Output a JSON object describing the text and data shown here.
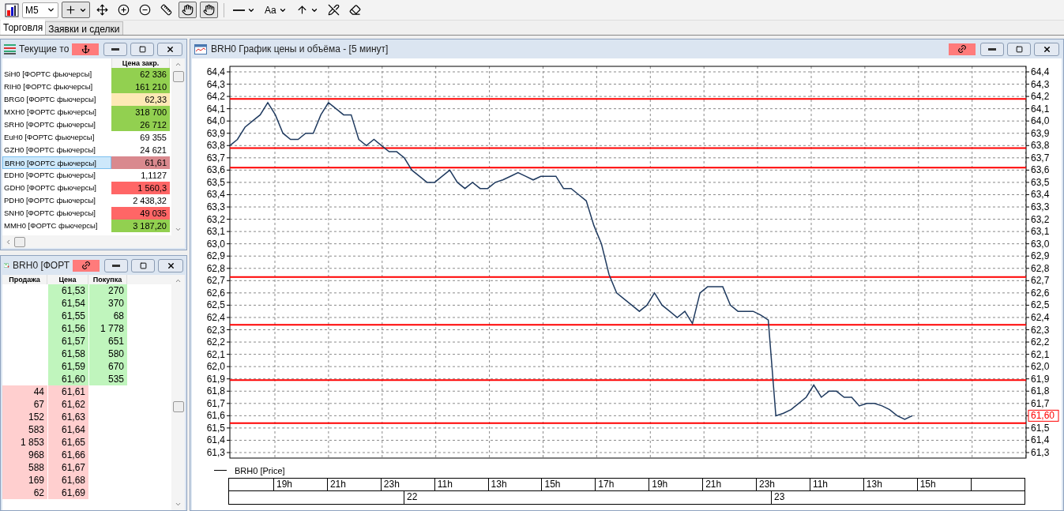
{
  "toolbar": {
    "timeframe": "M5",
    "tools": [
      {
        "kind": "icon",
        "pressed": true,
        "menu": true
      },
      {
        "kind": "icon",
        "pressed": false,
        "menu": false
      },
      {
        "kind": "icon",
        "pressed": false,
        "menu": false
      },
      {
        "kind": "icon",
        "pressed": false,
        "menu": false
      },
      {
        "kind": "icon",
        "pressed": false,
        "menu": false
      },
      {
        "kind": "icon",
        "pressed": true,
        "menu": false
      },
      {
        "kind": "icon",
        "pressed": true,
        "menu": false
      },
      {
        "kind": "separator"
      },
      {
        "kind": "icon",
        "pressed": false,
        "menu": true
      },
      {
        "kind": "text",
        "label": "Aa",
        "pressed": false,
        "menu": true
      },
      {
        "kind": "icon",
        "pressed": false,
        "menu": true
      },
      {
        "kind": "icon",
        "pressed": false,
        "menu": false
      },
      {
        "kind": "icon",
        "pressed": false,
        "menu": false
      }
    ]
  },
  "tabs": [
    {
      "label": "Торговля",
      "selected": true
    },
    {
      "label": "Заявки и сделки",
      "selected": false
    }
  ],
  "current_trades": {
    "title": "Текущие то",
    "columns": [
      "Цена закр."
    ],
    "rows": [
      {
        "name": "SiH0 [ФОРТС фьючерсы]",
        "value": "62 336",
        "color": "#92d050",
        "selected": false
      },
      {
        "name": "RIH0 [ФОРТС фьючерсы]",
        "value": "161 210",
        "color": "#92d050",
        "selected": false
      },
      {
        "name": "BRG0 [ФОРТС фьючерсы]",
        "value": "62,33",
        "color": "#fde9b5",
        "selected": false
      },
      {
        "name": "MXH0 [ФОРТС фьючерсы]",
        "value": "318 700",
        "color": "#92d050",
        "selected": false
      },
      {
        "name": "SRH0 [ФОРТС фьючерсы]",
        "value": "26 712",
        "color": "#92d050",
        "selected": false
      },
      {
        "name": "EuH0 [ФОРТС фьючерсы]",
        "value": "69 355",
        "color": "#ffffff",
        "selected": false
      },
      {
        "name": "GZH0 [ФОРТС фьючерсы]",
        "value": "24 621",
        "color": "#ffffff",
        "selected": false
      },
      {
        "name": "BRH0 [ФОРТС фьючерсы]",
        "value": "61,61",
        "color": "#d9898e",
        "selected": true
      },
      {
        "name": "EDH0 [ФОРТС фьючерсы]",
        "value": "1,1127",
        "color": "#ffffff",
        "selected": false
      },
      {
        "name": "GDH0 [ФОРТС фьючерсы]",
        "value": "1 560,3",
        "color": "#ff6666",
        "selected": false
      },
      {
        "name": "PDH0 [ФОРТС фьючерсы]",
        "value": "2 438,32",
        "color": "#ffffff",
        "selected": false
      },
      {
        "name": "SNH0 [ФОРТС фьючерсы]",
        "value": "49 035",
        "color": "#ff6666",
        "selected": false
      },
      {
        "name": "MMH0 [ФОРТС фьючерсы]",
        "value": "3 187,20",
        "color": "#92d050",
        "selected": false
      }
    ]
  },
  "order_book": {
    "title": "BRH0 [ФОРТ",
    "columns": [
      "Продажа",
      "Цена",
      "Покупка"
    ],
    "rows": [
      {
        "kind": "bid",
        "price": "61,53",
        "buy": "270"
      },
      {
        "kind": "bid",
        "price": "61,54",
        "buy": "370"
      },
      {
        "kind": "bid",
        "price": "61,55",
        "buy": "68"
      },
      {
        "kind": "bid",
        "price": "61,56",
        "buy": "1 778"
      },
      {
        "kind": "bid",
        "price": "61,57",
        "buy": "651"
      },
      {
        "kind": "bid",
        "price": "61,58",
        "buy": "580"
      },
      {
        "kind": "bid",
        "price": "61,59",
        "buy": "670"
      },
      {
        "kind": "bid",
        "price": "61,60",
        "buy": "535"
      },
      {
        "kind": "ask",
        "sell": "44",
        "price": "61,61"
      },
      {
        "kind": "ask",
        "sell": "67",
        "price": "61,62"
      },
      {
        "kind": "ask",
        "sell": "152",
        "price": "61,63"
      },
      {
        "kind": "ask",
        "sell": "583",
        "price": "61,64"
      },
      {
        "kind": "ask",
        "sell": "1 853",
        "price": "61,65"
      },
      {
        "kind": "ask",
        "sell": "968",
        "price": "61,66"
      },
      {
        "kind": "ask",
        "sell": "588",
        "price": "61,67"
      },
      {
        "kind": "ask",
        "sell": "169",
        "price": "61,68"
      },
      {
        "kind": "ask",
        "sell": "62",
        "price": "61,69"
      }
    ]
  },
  "chart_window": {
    "title": "BRH0 График цены и объёма - [5 минут]",
    "chart_data": {
      "type": "line",
      "grid": true,
      "ylim": [
        61.255,
        64.445
      ],
      "yticks": [
        {
          "value": 61.3,
          "label": "61,3"
        },
        {
          "value": 61.4,
          "label": "61,4"
        },
        {
          "value": 61.5,
          "label": "61,5"
        },
        {
          "value": 61.6,
          "label": "61,6"
        },
        {
          "value": 61.7,
          "label": "61,7"
        },
        {
          "value": 61.8,
          "label": "61,8"
        },
        {
          "value": 61.9,
          "label": "61,9"
        },
        {
          "value": 62.0,
          "label": "62,0"
        },
        {
          "value": 62.1,
          "label": "62,1"
        },
        {
          "value": 62.2,
          "label": "62,2"
        },
        {
          "value": 62.3,
          "label": "62,3"
        },
        {
          "value": 62.4,
          "label": "62,4"
        },
        {
          "value": 62.5,
          "label": "62,5"
        },
        {
          "value": 62.6,
          "label": "62,6"
        },
        {
          "value": 62.7,
          "label": "62,7"
        },
        {
          "value": 62.8,
          "label": "62,8"
        },
        {
          "value": 62.9,
          "label": "62,9"
        },
        {
          "value": 63.0,
          "label": "63,0"
        },
        {
          "value": 63.1,
          "label": "63,1"
        },
        {
          "value": 63.2,
          "label": "63,2"
        },
        {
          "value": 63.3,
          "label": "63,3"
        },
        {
          "value": 63.4,
          "label": "63,4"
        },
        {
          "value": 63.5,
          "label": "63,5"
        },
        {
          "value": 63.6,
          "label": "63,6"
        },
        {
          "value": 63.7,
          "label": "63,7"
        },
        {
          "value": 63.8,
          "label": "63,8"
        },
        {
          "value": 63.9,
          "label": "63,9"
        },
        {
          "value": 64.0,
          "label": "64,0"
        },
        {
          "value": 64.1,
          "label": "64,1"
        },
        {
          "value": 64.2,
          "label": "64,2"
        },
        {
          "value": 64.3,
          "label": "64,3"
        },
        {
          "value": 64.4,
          "label": "64,4"
        }
      ],
      "series": [
        {
          "name": "BRH0 [Price]",
          "color": "#1f3a5f",
          "values": [
            63.8,
            63.85,
            63.95,
            64.0,
            64.05,
            64.15,
            64.05,
            63.9,
            63.85,
            63.85,
            63.9,
            63.9,
            64.05,
            64.15,
            64.1,
            64.05,
            64.05,
            63.85,
            63.8,
            63.85,
            63.8,
            63.75,
            63.75,
            63.7,
            63.6,
            63.55,
            63.5,
            63.5,
            63.55,
            63.6,
            63.5,
            63.45,
            63.5,
            63.45,
            63.45,
            63.5,
            63.52,
            63.55,
            63.58,
            63.55,
            63.52,
            63.55,
            63.55,
            63.55,
            63.45,
            63.45,
            63.4,
            63.35,
            63.15,
            63.0,
            62.75,
            62.6,
            62.55,
            62.5,
            62.45,
            62.5,
            62.6,
            62.5,
            62.45,
            62.4,
            62.45,
            62.35,
            62.6,
            62.65,
            62.65,
            62.65,
            62.5,
            62.45,
            62.45,
            62.45,
            62.42,
            62.38,
            61.6,
            61.62,
            61.65,
            61.7,
            61.75,
            61.85,
            61.75,
            61.8,
            61.8,
            61.75,
            61.75,
            61.68,
            61.7,
            61.7,
            61.68,
            61.65,
            61.6,
            61.57,
            61.6
          ]
        }
      ],
      "ref_lines": [
        {
          "axis": "y",
          "value": 64.18
        },
        {
          "axis": "y",
          "value": 63.78
        },
        {
          "axis": "y",
          "value": 63.62
        },
        {
          "axis": "y",
          "value": 62.73
        },
        {
          "axis": "y",
          "value": 62.34
        },
        {
          "axis": "y",
          "value": 61.89
        },
        {
          "axis": "y",
          "value": 61.54
        }
      ]
    },
    "right_axis_labels": [
      "64,4",
      "64,3",
      "64,2",
      "64,1",
      "64,0",
      "63,9",
      "63,8",
      "63,7",
      "63,6",
      "63,5",
      "63,4",
      "63,3",
      "63,2",
      "63,1",
      "63,0",
      "62,9",
      "62,8",
      "62,7",
      "62,6",
      "62,5",
      "62,4",
      "62,3",
      "62,2",
      "62,1",
      "62,0",
      "61,9",
      "61,8",
      "61,7",
      "61,5",
      "61,4",
      "61,3"
    ],
    "last_price": "61,60",
    "time_axis": {
      "hours": [
        "19h",
        "21h",
        "23h",
        "11h",
        "13h",
        "15h",
        "17h",
        "19h",
        "21h",
        "23h",
        "11h",
        "13h",
        "15h"
      ],
      "days": [
        "22",
        "23"
      ]
    }
  }
}
